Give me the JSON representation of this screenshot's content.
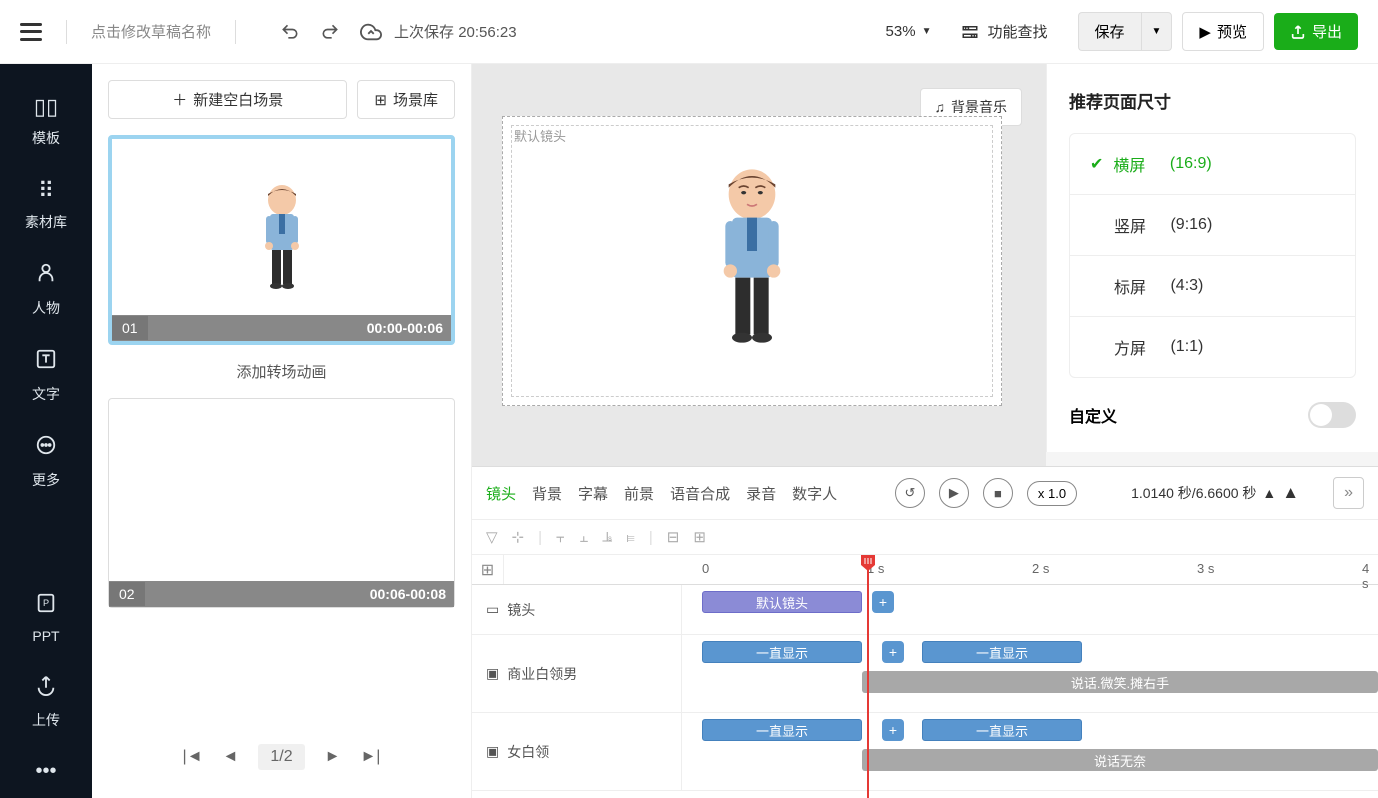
{
  "topbar": {
    "draft_name": "点击修改草稿名称",
    "last_save_label": "上次保存",
    "last_save_time": "20:56:23",
    "zoom": "53%",
    "func_search": "功能查找",
    "save": "保存",
    "preview": "预览",
    "export": "导出"
  },
  "sidebar": {
    "items": [
      {
        "label": "模板"
      },
      {
        "label": "素材库"
      },
      {
        "label": "人物"
      },
      {
        "label": "文字"
      },
      {
        "label": "更多"
      },
      {
        "label": "PPT"
      },
      {
        "label": "上传"
      }
    ]
  },
  "scene_panel": {
    "new_blank": "新建空白场景",
    "scene_lib": "场景库",
    "transition": "添加转场动画",
    "scenes": [
      {
        "num": "01",
        "time": "00:00-00:06"
      },
      {
        "num": "02",
        "time": "00:06-00:08"
      }
    ],
    "pager": "1/2"
  },
  "canvas": {
    "bg_music": "背景音乐",
    "default_shot": "默认镜头"
  },
  "right_panel": {
    "title": "推荐页面尺寸",
    "items": [
      {
        "label": "横屏",
        "ratio": "(16:9)"
      },
      {
        "label": "竖屏",
        "ratio": "(9:16)"
      },
      {
        "label": "标屏",
        "ratio": "(4:3)"
      },
      {
        "label": "方屏",
        "ratio": "(1:1)"
      }
    ],
    "custom": "自定义"
  },
  "timeline": {
    "tabs": [
      "镜头",
      "背景",
      "字幕",
      "前景",
      "语音合成",
      "录音",
      "数字人"
    ],
    "speed": "x 1.0",
    "time_display": "1.0140 秒/6.6600 秒",
    "ticks": [
      "0",
      "1 s",
      "2 s",
      "3 s",
      "4 s"
    ],
    "rows": [
      {
        "label": "镜头",
        "icon": "video"
      },
      {
        "label": "商业白领男",
        "icon": "image"
      },
      {
        "label": "女白领",
        "icon": "image"
      }
    ],
    "clips": {
      "default_shot": "默认镜头",
      "always_show": "一直显示",
      "talk_smile_wave": "说话.微笑.摊右手",
      "talk_helpless": "说话无奈"
    }
  }
}
